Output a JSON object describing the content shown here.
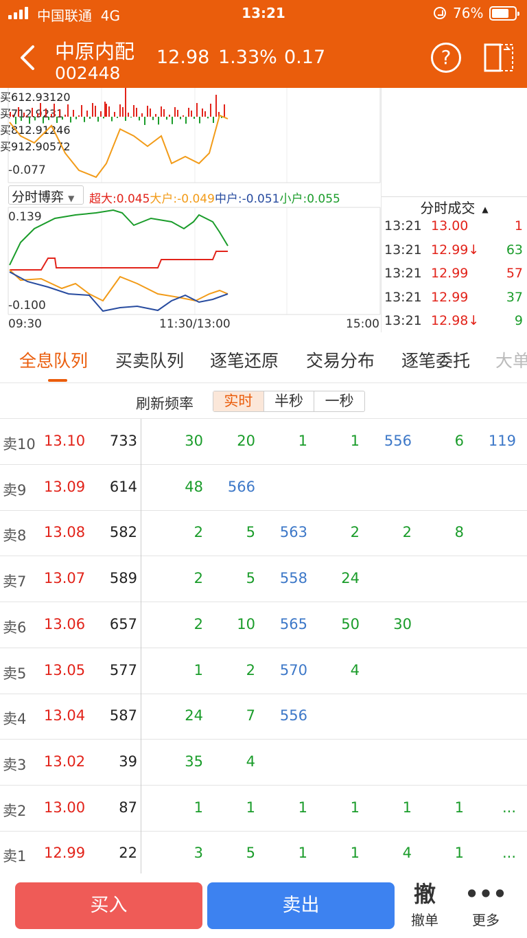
{
  "status": {
    "carrier": "中国联通",
    "network": "4G",
    "time": "13:21",
    "battery": "76%",
    "battery_level": 0.76
  },
  "header": {
    "name": "中原内配",
    "code": "002448",
    "price": "12.98",
    "pct": "1.33%",
    "change": "0.17"
  },
  "top_chart": {
    "min_label": "-0.077"
  },
  "game": {
    "selector": "分时博弈",
    "legend": [
      {
        "text": "超大:0.045",
        "color": "#e2231a"
      },
      {
        "text": "大户:-0.049",
        "color": "#f29b18"
      },
      {
        "text": "中户:-0.051",
        "color": "#274b9f"
      },
      {
        "text": "小户:0.055",
        "color": "#1a9c2a"
      }
    ],
    "max_label": "0.139",
    "min_label": "-0.100",
    "time_start": "09:30",
    "time_mid": "11:30/13:00",
    "time_end": "15:00"
  },
  "orderbook": [
    {
      "label": "买6",
      "price": "12.93",
      "volume": "120",
      "dot": "#cccccc"
    },
    {
      "label": "买7",
      "price": "12.92",
      "volume": "31",
      "dot": "#cccccc"
    },
    {
      "label": "买8",
      "price": "12.91",
      "volume": "246",
      "dot": "#ea5d0c"
    },
    {
      "label": "买9",
      "price": "12.90",
      "volume": "572",
      "dot": "#ea5d0c"
    }
  ],
  "ticks": {
    "title": "分时成交",
    "rows": [
      {
        "time": "13:21",
        "price": "13.00",
        "volume": "1",
        "color": "#e2231a"
      },
      {
        "time": "13:21",
        "price": "12.99↓",
        "volume": "63",
        "color": "#1a9c2a"
      },
      {
        "time": "13:21",
        "price": "12.99",
        "volume": "57",
        "color": "#e2231a"
      },
      {
        "time": "13:21",
        "price": "12.99",
        "volume": "37",
        "color": "#1a9c2a"
      },
      {
        "time": "13:21",
        "price": "12.98↓",
        "volume": "9",
        "color": "#1a9c2a"
      }
    ]
  },
  "tabs": [
    "全息队列",
    "买卖队列",
    "逐笔还原",
    "交易分布",
    "逐笔委托",
    "大单"
  ],
  "refresh": {
    "label": "刷新频率",
    "options": [
      "实时",
      "半秒",
      "一秒"
    ],
    "selected": 0
  },
  "queue": [
    {
      "label": "卖10",
      "price": "13.10",
      "volume": "733",
      "cells": [
        "30",
        "20",
        "1",
        "1",
        "556",
        "6",
        "119"
      ]
    },
    {
      "label": "卖9",
      "price": "13.09",
      "volume": "614",
      "cells": [
        "48",
        "566"
      ]
    },
    {
      "label": "卖8",
      "price": "13.08",
      "volume": "582",
      "cells": [
        "2",
        "5",
        "563",
        "2",
        "2",
        "8"
      ]
    },
    {
      "label": "卖7",
      "price": "13.07",
      "volume": "589",
      "cells": [
        "2",
        "5",
        "558",
        "24"
      ]
    },
    {
      "label": "卖6",
      "price": "13.06",
      "volume": "657",
      "cells": [
        "2",
        "10",
        "565",
        "50",
        "30"
      ]
    },
    {
      "label": "卖5",
      "price": "13.05",
      "volume": "577",
      "cells": [
        "1",
        "2",
        "570",
        "4"
      ]
    },
    {
      "label": "卖4",
      "price": "13.04",
      "volume": "587",
      "cells": [
        "24",
        "7",
        "556"
      ]
    },
    {
      "label": "卖3",
      "price": "13.02",
      "volume": "39",
      "cells": [
        "35",
        "4"
      ]
    },
    {
      "label": "卖2",
      "price": "13.00",
      "volume": "87",
      "cells": [
        "1",
        "1",
        "1",
        "1",
        "1",
        "1",
        "..."
      ]
    },
    {
      "label": "卖1",
      "price": "12.99",
      "volume": "22",
      "cells": [
        "3",
        "5",
        "1",
        "1",
        "4",
        "1",
        "..."
      ]
    }
  ],
  "bottom": {
    "buy": "买入",
    "sell": "卖出",
    "cancel_icon": "撤",
    "cancel": "撤单",
    "more": "更多"
  }
}
